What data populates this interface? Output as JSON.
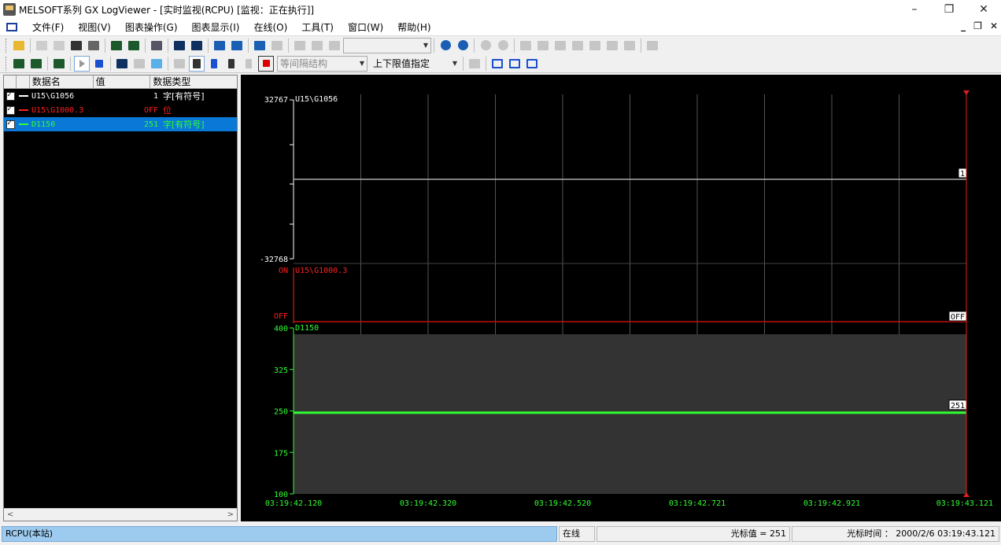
{
  "window": {
    "title": "MELSOFT系列 GX LogViewer - [实时监视(RCPU) [监视：正在执行]]",
    "minimize": "–",
    "restore": "❐",
    "close": "✕"
  },
  "menu": {
    "items": [
      "文件(F)",
      "视图(V)",
      "图表操作(G)",
      "图表显示(I)",
      "在线(O)",
      "工具(T)",
      "窗口(W)",
      "帮助(H)"
    ],
    "mdi_min": "_",
    "mdi_restore": "❐",
    "mdi_close": "✕"
  },
  "toolbar2": {
    "interval_combo": "等间隔结构",
    "limit_combo": "上下限值指定"
  },
  "data_list": {
    "headers": [
      "数据名",
      "值",
      "数据类型"
    ],
    "rows": [
      {
        "name": "U15\\G1056",
        "value": "1",
        "type": "字[有符号]",
        "color": "#ffffff"
      },
      {
        "name": "U15\\G1000.3",
        "value": "OFF",
        "type": "位",
        "color": "#ff2020"
      },
      {
        "name": "D1150",
        "value": "251",
        "type": "字[有符号]",
        "color": "#30ff30"
      }
    ]
  },
  "chart_data": {
    "type": "line",
    "x_ticks": [
      "03:19:42.120",
      "03:19:42.320",
      "03:19:42.520",
      "03:19:42.721",
      "03:19:42.921",
      "03:19:43.121"
    ],
    "panels": [
      {
        "name": "U15\\G1056",
        "color": "#ffffff",
        "ymax": "32767",
        "ymin": "-32768",
        "value": 1,
        "cursor_label": "1"
      },
      {
        "name": "U15\\G1000.3",
        "color": "#ff2020",
        "ymax": "ON",
        "ymin": "OFF",
        "value": "OFF",
        "cursor_label": "OFF"
      },
      {
        "name": "D1150",
        "color": "#30ff30",
        "y_ticks": [
          "400",
          "325",
          "250",
          "175",
          "100"
        ],
        "value": 251,
        "cursor_label": "251",
        "ylim": [
          100,
          400
        ]
      }
    ]
  },
  "status": {
    "station": "RCPU(本站)",
    "online": "在线",
    "cursor_value": "光标值 = 251",
    "cursor_time": "光标时间 ： 2000/2/6 03:19:43.121"
  }
}
